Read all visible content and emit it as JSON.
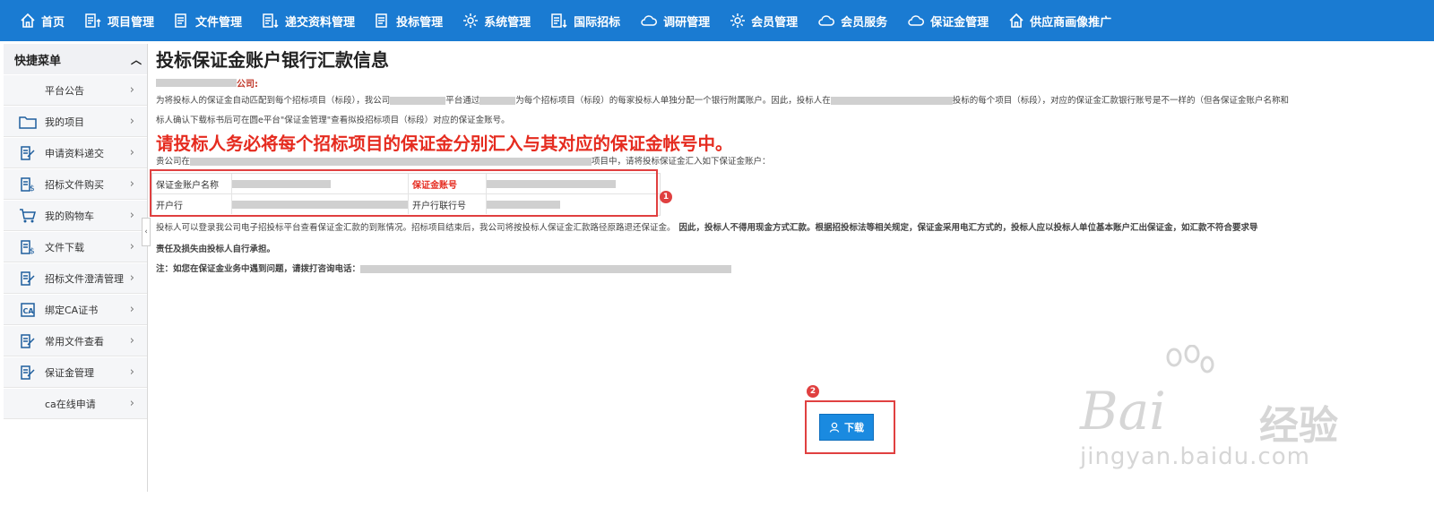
{
  "nav": {
    "items": [
      {
        "label": "首页",
        "icon": "home-icon"
      },
      {
        "label": "项目管理",
        "icon": "doc-up-icon"
      },
      {
        "label": "文件管理",
        "icon": "doc-icon"
      },
      {
        "label": "递交资料管理",
        "icon": "doc-down-icon"
      },
      {
        "label": "投标管理",
        "icon": "doc-icon"
      },
      {
        "label": "系统管理",
        "icon": "gear-icon"
      },
      {
        "label": "国际招标",
        "icon": "doc-down-icon"
      },
      {
        "label": "调研管理",
        "icon": "cloud-icon"
      },
      {
        "label": "会员管理",
        "icon": "gear-icon"
      },
      {
        "label": "会员服务",
        "icon": "cloud-icon"
      },
      {
        "label": "保证金管理",
        "icon": "cloud-icon"
      },
      {
        "label": "供应商画像推广",
        "icon": "home-icon"
      }
    ]
  },
  "sidebar": {
    "title": "快捷菜单",
    "items": [
      {
        "label": "平台公告",
        "icon": ""
      },
      {
        "label": "我的项目",
        "icon": "folder-icon"
      },
      {
        "label": "申请资料递交",
        "icon": "edit-doc-icon"
      },
      {
        "label": "招标文件购买",
        "icon": "dollar-doc-icon"
      },
      {
        "label": "我的购物车",
        "icon": "cart-icon"
      },
      {
        "label": "文件下载",
        "icon": "dollar-doc-icon"
      },
      {
        "label": "招标文件澄清管理",
        "icon": "edit-doc-icon"
      },
      {
        "label": "绑定CA证书",
        "icon": "ca-icon"
      },
      {
        "label": "常用文件查看",
        "icon": "edit-doc-icon"
      },
      {
        "label": "保证金管理",
        "icon": "edit-doc-icon"
      },
      {
        "label": "ca在线申请",
        "icon": ""
      }
    ]
  },
  "main": {
    "title": "投标保证金账户银行汇款信息",
    "company_suffix": "公司:",
    "p1a": "为将投标人的保证金自动匹配到每个招标项目（标段），我公司",
    "p1b": "平台通过",
    "p1c": "为每个招标项目（标段）的每家投标人单独分配一个银行附属账户。因此，投标人在",
    "p1d": "投标的每个项目（标段），对应的保证金汇款银行账号是不一样的（但各保证金账户名称和",
    "p2": "标人确认下载标书后可在圆e平台\"保证金管理\"查看拟投招标项目（标段）对应的保证金账号。",
    "warning": "请投标人务必将每个招标项目的保证金分别汇入与其对应的保证金帐号中。",
    "p3a": "贵公司在",
    "p3b": "项目中，请将投标保证金汇入如下保证金账户：",
    "account": {
      "name_label": "保证金账户名称",
      "number_label": "保证金账号",
      "bank_label": "开户行",
      "bank_no_label": "开户行联行号"
    },
    "p4": "投标人可以登录我公司电子招投标平台查看保证金汇款的到账情况。招标项目结束后，我公司将按投标人保证金汇款路径原路退还保证金。",
    "p4b": "因此，投标人不得用现金方式汇款。根据招投标法等相关规定，保证金采用电汇方式的，投标人应以投标人单位基本账户汇出保证金，如汇款不符合要求导",
    "p5": "责任及损失由投标人自行承担。",
    "note": "注：如您在保证金业务中遇到问题，请拨打咨询电话：",
    "download_label": "下载"
  },
  "annotations": {
    "badge1": "1",
    "badge2": "2"
  },
  "watermark": {
    "brand": "Bai",
    "brand_cn": "经验",
    "url": "jingyan.baidu.com"
  }
}
